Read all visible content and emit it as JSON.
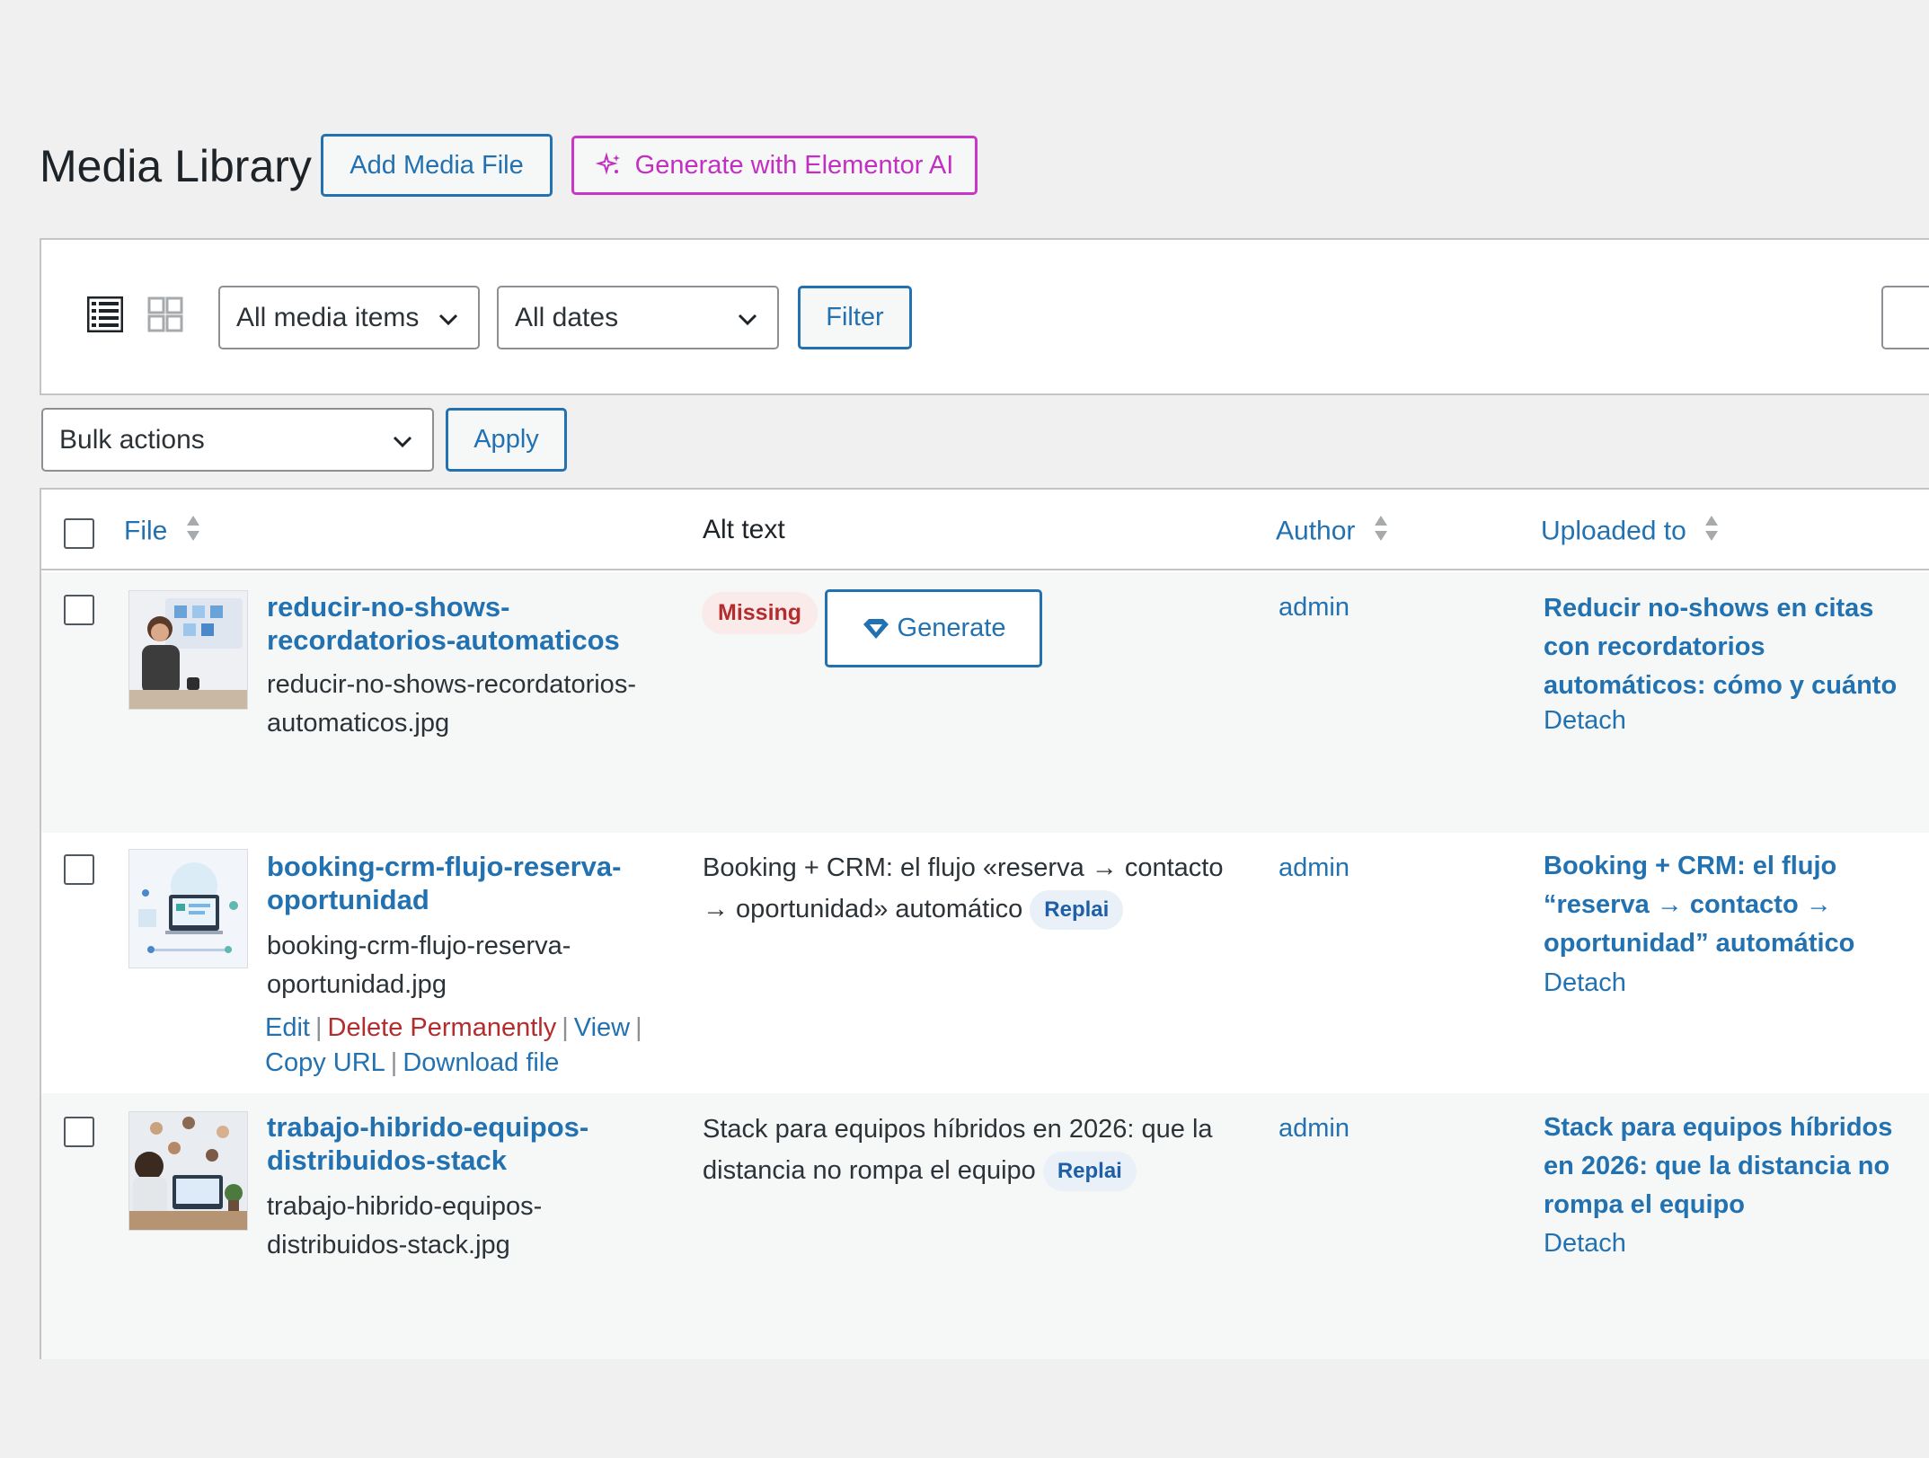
{
  "header": {
    "title": "Media Library",
    "add_media_label": "Add Media File",
    "generate_ai_label": "Generate with Elementor AI"
  },
  "toolbar": {
    "view_modes": [
      "list-view-icon",
      "grid-view-icon"
    ],
    "media_filter": "All media items",
    "date_filter": "All dates",
    "filter_label": "Filter",
    "bulk_actions": "Bulk actions",
    "apply_label": "Apply"
  },
  "table": {
    "columns": {
      "file": "File",
      "alt_text": "Alt text",
      "author": "Author",
      "uploaded_to": "Uploaded to"
    },
    "rows": [
      {
        "title_line1": "reducir-no-shows-",
        "title_line2": "recordatorios-automaticos",
        "filename_line1": "reducir-no-shows-recordatorios-",
        "filename_line2": "automaticos.jpg",
        "alt_status": "Missing",
        "generate_label": "Generate",
        "author": "admin",
        "uploaded_line1": "Reducir no-shows en citas",
        "uploaded_line2": "con recordatorios",
        "uploaded_line3": "automáticos: cómo y cuánto",
        "detach": "Detach"
      },
      {
        "title_line1": "booking-crm-flujo-reserva-",
        "title_line2": "oportunidad",
        "filename_line1": "booking-crm-flujo-reserva-",
        "filename_line2": "oportunidad.jpg",
        "alt_line1": "Booking + CRM: el flujo «reserva → contacto",
        "alt_line2": "→ oportunidad» automático",
        "alt_pill": "Replai",
        "author": "admin",
        "uploaded_line1": "Booking + CRM: el flujo",
        "uploaded_line2": "“reserva → contacto →",
        "uploaded_line3": "oportunidad” automático",
        "detach": "Detach",
        "actions": {
          "edit": "Edit",
          "delete": "Delete Permanently",
          "view": "View",
          "copy_url": "Copy URL",
          "download": "Download file"
        }
      },
      {
        "title_line1": "trabajo-hibrido-equipos-",
        "title_line2": "distribuidos-stack",
        "filename_line1": "trabajo-hibrido-equipos-",
        "filename_line2": "distribuidos-stack.jpg",
        "alt_line1": "Stack para equipos híbridos en 2026: que la",
        "alt_line2": "distancia no rompa el equipo",
        "alt_pill": "Replai",
        "author": "admin",
        "uploaded_line1": "Stack para equipos híbridos",
        "uploaded_line2": "en 2026: que la distancia no",
        "uploaded_line3": "rompa el equipo",
        "detach": "Detach"
      }
    ]
  },
  "colors": {
    "link": "#2271b1",
    "ai_accent": "#c22fc2",
    "danger": "#b32d2e",
    "pill_bg": "#e9f0f8"
  }
}
